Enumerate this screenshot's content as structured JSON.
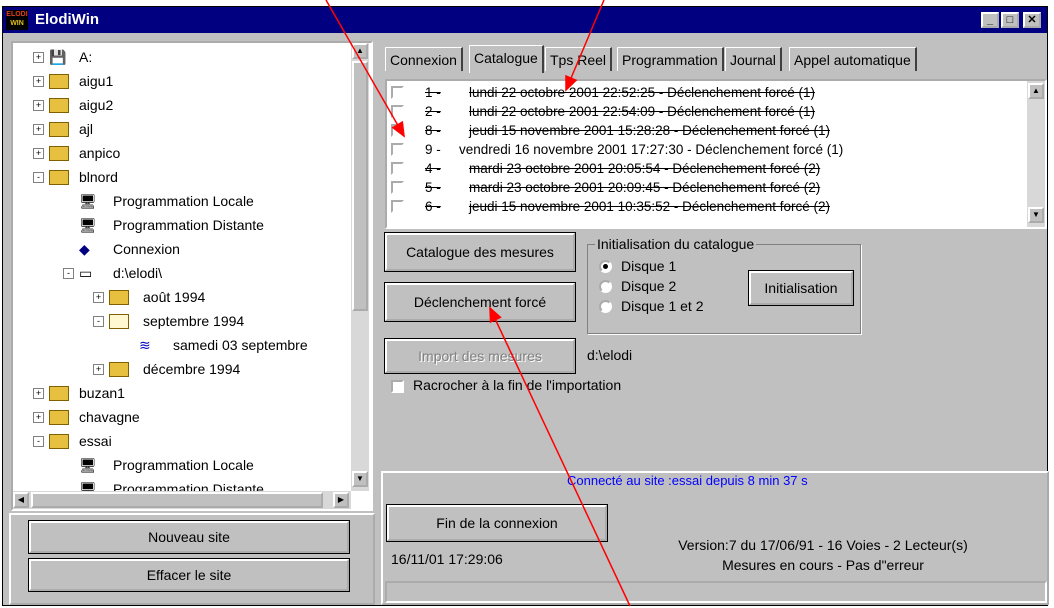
{
  "window": {
    "title": "ElodiWin",
    "icon_text_top": "ELODI",
    "icon_text_bottom": "WIN"
  },
  "caption_buttons": {
    "minimize": "_",
    "maximize": "□",
    "close": "✕"
  },
  "tree": {
    "items": [
      {
        "label": "A:",
        "icon": "floppy-icon",
        "indent": 0,
        "expander": "+"
      },
      {
        "label": "aigu1",
        "icon": "site-icon",
        "indent": 0,
        "expander": "+"
      },
      {
        "label": "aigu2",
        "icon": "site-icon",
        "indent": 0,
        "expander": "+"
      },
      {
        "label": "ajl",
        "icon": "site-icon",
        "indent": 0,
        "expander": "+"
      },
      {
        "label": "anpico",
        "icon": "site-icon",
        "indent": 0,
        "expander": "+"
      },
      {
        "label": "blnord",
        "icon": "site-icon",
        "indent": 0,
        "expander": "-"
      },
      {
        "label": "Programmation Locale",
        "icon": "computer-icon",
        "indent": 1,
        "expander": ""
      },
      {
        "label": "Programmation Distante",
        "icon": "computer-icon",
        "indent": 1,
        "expander": ""
      },
      {
        "label": "Connexion",
        "icon": "connection-icon",
        "indent": 1,
        "expander": ""
      },
      {
        "label": "d:\\elodi\\",
        "icon": "drive-icon",
        "indent": 1,
        "expander": "-"
      },
      {
        "label": "août 1994",
        "icon": "folder-icon",
        "indent": 2,
        "expander": "+"
      },
      {
        "label": "septembre 1994",
        "icon": "folder-open-icon",
        "indent": 2,
        "expander": "-"
      },
      {
        "label": "samedi 03 septembre",
        "icon": "elodi-file-icon",
        "indent": 3,
        "expander": ""
      },
      {
        "label": "décembre 1994",
        "icon": "folder-icon",
        "indent": 2,
        "expander": "+"
      },
      {
        "label": "buzan1",
        "icon": "site-icon",
        "indent": 0,
        "expander": "+"
      },
      {
        "label": "chavagne",
        "icon": "site-icon",
        "indent": 0,
        "expander": "+"
      },
      {
        "label": "essai",
        "icon": "site-icon",
        "indent": 0,
        "expander": "-"
      },
      {
        "label": "Programmation Locale",
        "icon": "computer-icon",
        "indent": 1,
        "expander": ""
      },
      {
        "label": "Programmation Distante",
        "icon": "computer-icon",
        "indent": 1,
        "expander": ""
      }
    ]
  },
  "left_buttons": {
    "new_site": "Nouveau site",
    "delete_site": "Effacer le site"
  },
  "tabs": [
    {
      "label": "Connexion"
    },
    {
      "label": "Catalogue"
    },
    {
      "label": "Tps Reel"
    },
    {
      "label": "Programmation"
    },
    {
      "label": "Journal"
    },
    {
      "label": "Appel automatique"
    }
  ],
  "catalogue_list": [
    {
      "num": "1 -",
      "text": "lundi 22 octobre 2001 22:52:25 - Déclenchement forcé (1)",
      "struck": true
    },
    {
      "num": "2 -",
      "text": "lundi 22 octobre 2001 22:54:09 - Déclenchement forcé (1)",
      "struck": true
    },
    {
      "num": "8 -",
      "text": "jeudi 15 novembre 2001 15:28:28 - Déclenchement forcé (1)",
      "struck": true
    },
    {
      "num": "9 -",
      "text": "vendredi 16 novembre 2001 17:27:30 - Déclenchement forcé (1)",
      "struck": false
    },
    {
      "num": "4 -",
      "text": "mardi 23 octobre 2001 20:05:54 - Déclenchement forcé (2)",
      "struck": true
    },
    {
      "num": "5 -",
      "text": "mardi 23 octobre 2001 20:09:45 - Déclenchement forcé (2)",
      "struck": true
    },
    {
      "num": "6 -",
      "text": "jeudi 15 novembre 2001 10:35:52 - Déclenchement forcé (2)",
      "struck": true
    }
  ],
  "buttons": {
    "catalogue_mesures": "Catalogue des mesures",
    "declenchement_force": "Déclenchement forcé",
    "import_mesures": "Import des mesures",
    "initialisation": "Initialisation",
    "fin_connexion": "Fin de la connexion"
  },
  "init_group": {
    "title": "Initialisation du catalogue",
    "options": [
      {
        "label": "Disque 1",
        "selected": true
      },
      {
        "label": "Disque 2",
        "selected": false
      },
      {
        "label": "Disque 1 et 2",
        "selected": false
      }
    ]
  },
  "import_path": "d:\\elodi",
  "rehook_checkbox": {
    "label": "Racrocher à la fin de l'importation",
    "checked": false
  },
  "status": {
    "connected": "Connecté au site :essai depuis 8 min 37 s",
    "connected_color": "#0000ff",
    "datetime": "16/11/01 17:29:06",
    "version": "Version:7 du 17/06/91 - 16 Voies - 2 Lecteur(s)",
    "state": "Mesures en cours - Pas d\"erreur"
  },
  "annotation_color": "#ff0000"
}
